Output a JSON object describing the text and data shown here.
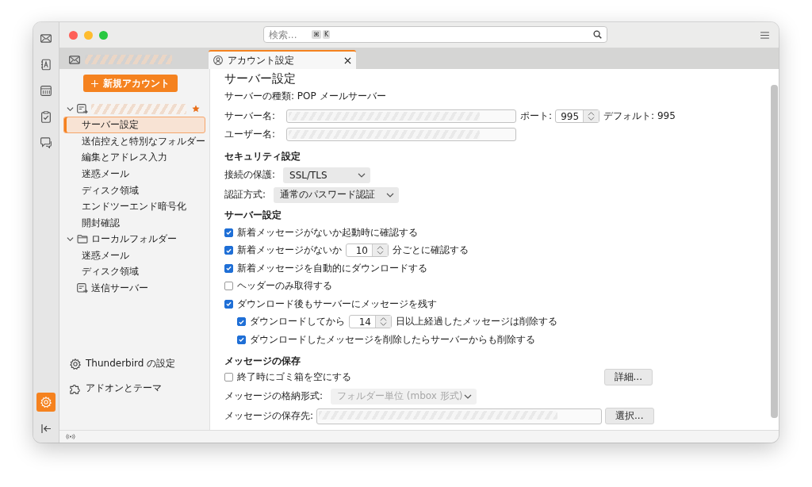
{
  "search": {
    "placeholder": "検索...",
    "shortcut_keys": [
      "⌘",
      "K"
    ]
  },
  "spaces": [
    {
      "kind": "mail",
      "selected": false
    },
    {
      "kind": "address-book",
      "selected": false
    },
    {
      "kind": "calendar",
      "selected": false
    },
    {
      "kind": "tasks",
      "selected": false
    },
    {
      "kind": "chat",
      "selected": false
    }
  ],
  "spaces_bottom": [
    {
      "kind": "settings",
      "selected": true
    },
    {
      "kind": "collapse",
      "selected": false
    }
  ],
  "tabs": [
    {
      "kind": "mail",
      "redacted": true,
      "selected": false
    },
    {
      "kind": "account",
      "label": "アカウント設定",
      "selected": true
    }
  ],
  "sidebar": {
    "new_account_button": "新規アカウント",
    "tree": [
      {
        "kind": "account",
        "redacted": true,
        "default": true,
        "expanded": true,
        "children": [
          {
            "label": "サーバー設定",
            "selected": true
          },
          {
            "label": "送信控えと特別なフォルダー",
            "selected": false
          },
          {
            "label": "編集とアドレス入力",
            "selected": false
          },
          {
            "label": "迷惑メール",
            "selected": false
          },
          {
            "label": "ディスク領域",
            "selected": false
          },
          {
            "label": "エンドツーエンド暗号化",
            "selected": false
          },
          {
            "label": "開封確認",
            "selected": false
          }
        ]
      },
      {
        "kind": "folder",
        "label": "ローカルフォルダー",
        "default": false,
        "expanded": true,
        "children": [
          {
            "label": "迷惑メール",
            "selected": false
          },
          {
            "label": "ディスク領域",
            "selected": false
          }
        ]
      },
      {
        "kind": "outgoing",
        "label": "送信サーバー",
        "default": false
      }
    ],
    "footer": [
      {
        "kind": "settings",
        "label": "Thunderbird の設定"
      },
      {
        "kind": "addons",
        "label": "アドオンとテーマ"
      }
    ]
  },
  "content": {
    "title": "サーバー設定",
    "server_type": "サーバーの種類: POP メールサーバー",
    "server_name": {
      "label": "サーバー名:",
      "redacted": true
    },
    "port": {
      "label": "ポート:",
      "value": "995",
      "default": "デフォルト: 995"
    },
    "user_name": {
      "label": "ユーザー名:",
      "redacted": true
    },
    "security": {
      "heading": "セキュリティ設定",
      "selects": [
        {
          "label": "接続の保護:",
          "value": "SSL/TLS"
        },
        {
          "label": "認証方式:",
          "value": "通常のパスワード認証"
        }
      ]
    },
    "server_settings": {
      "heading": "サーバー設定",
      "options": [
        {
          "kind": "check",
          "label": "新着メッセージがないか起動時に確認する",
          "checked": true
        },
        {
          "kind": "number",
          "before": "新着メッセージがないか",
          "value": "10",
          "after": "分ごとに確認する",
          "checked": true
        },
        {
          "kind": "check",
          "label": "新着メッセージを自動的にダウンロードする",
          "checked": true
        },
        {
          "kind": "check",
          "label": "ヘッダーのみ取得する",
          "checked": false
        },
        {
          "kind": "check",
          "label": "ダウンロード後もサーバーにメッセージを残す",
          "checked": true,
          "children": [
            {
              "kind": "number",
              "before": "ダウンロードしてから",
              "value": "14",
              "after": "日以上経過したメッセージは削除する",
              "checked": true
            },
            {
              "kind": "check",
              "label": "ダウンロードしたメッセージを削除したらサーバーからも削除する",
              "checked": true
            }
          ]
        }
      ]
    },
    "storage": {
      "heading": "メッセージの保存",
      "empty_trash": {
        "label": "終了時にゴミ箱を空にする",
        "checked": false
      },
      "advanced_button": "詳細...",
      "format": {
        "label": "メッセージの格納形式:",
        "value": "フォルダー単位 (mbox 形式)",
        "disabled": true
      },
      "location": {
        "label": "メッセージの保存先:",
        "redacted": true,
        "button": "選択..."
      }
    }
  }
}
